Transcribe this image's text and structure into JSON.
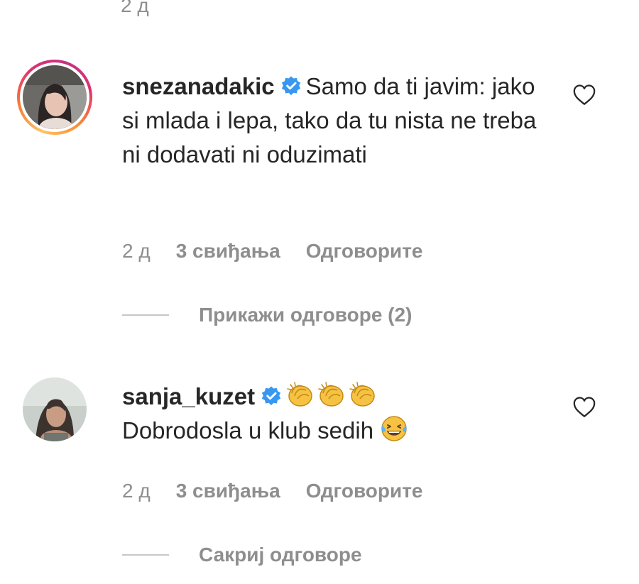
{
  "previous_comment": {
    "time": "2 д"
  },
  "comments": [
    {
      "username": "snezanadakic",
      "verified": true,
      "text": "Samo da ti javim: jako si mlada i lepa, tako da tu nista ne treba ni dodavati ni oduzimati",
      "time": "2 д",
      "likes": "3 свиђања",
      "reply_label": "Одговорите",
      "replies_toggle": "Прикажи одговоре (2)",
      "has_story_ring": true,
      "icon": "heart-icon"
    },
    {
      "username": "sanja_kuzet",
      "verified": true,
      "emojis": [
        "clapping-hands",
        "clapping-hands",
        "clapping-hands"
      ],
      "text": "Dobrodosla u klub sedih",
      "text_emoji": "laughing-tears",
      "time": "2 д",
      "likes": "3 свиђања",
      "reply_label": "Одговорите",
      "replies_toggle": "Сакриј одговоре",
      "has_story_ring": false,
      "icon": "heart-icon"
    }
  ],
  "colors": {
    "text": "#262626",
    "secondary": "#8e8e8e",
    "verified": "#3897f0",
    "divider": "#c7c7c7"
  }
}
